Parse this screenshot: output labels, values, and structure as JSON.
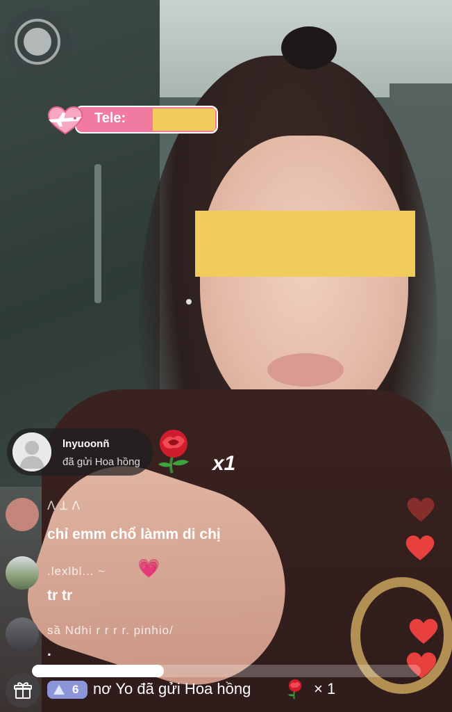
{
  "tele_badge": {
    "label": "Tele:"
  },
  "gift_toast": {
    "username": "lnyuoonñ",
    "action": "đã gửi Hoa hồng",
    "count": "x1",
    "gift_icon": "rose-icon"
  },
  "comments": [
    {
      "username": "ꓥ ꓕ ꓥ",
      "text": "chỉ emm chổ làmm di chị"
    },
    {
      "username": ".lexlbl... ~",
      "text": "tr tr",
      "emoji": "💗"
    },
    {
      "username": "sầ Ndhi r r r r. pinhio/",
      "text": "."
    }
  ],
  "bottom_bar": {
    "level": "6",
    "message": "nơ Yo đã gửi Hoa hồng",
    "count": "× 1",
    "progress": 0.34
  },
  "colors": {
    "censor": "#f1cc5c",
    "tele_pill": "#f07aa0",
    "level_badge": "#8b95d8",
    "heart": "#e8403f"
  }
}
